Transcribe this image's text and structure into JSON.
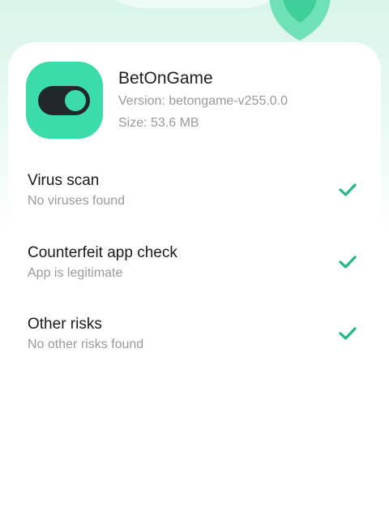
{
  "app": {
    "name": "BetOnGame",
    "version": "Version: betongame-v255.0.0",
    "size": "Size: 53.6 MB",
    "icon": "toggle-switch-icon"
  },
  "checks": [
    {
      "title": "Virus scan",
      "subtitle": "No viruses found",
      "status_icon": "check-icon"
    },
    {
      "title": "Counterfeit app check",
      "subtitle": "App is legitimate",
      "status_icon": "check-icon"
    },
    {
      "title": "Other risks",
      "subtitle": "No other risks found",
      "status_icon": "check-icon"
    }
  ],
  "colors": {
    "accent": "#3bdcaa",
    "check": "#1fb985",
    "header_bg": "#d9f5ea"
  }
}
